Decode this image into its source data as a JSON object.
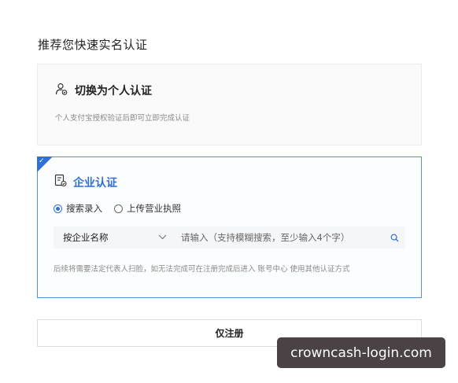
{
  "page": {
    "title": "推荐您快速实名认证"
  },
  "personal_card": {
    "title": "切换为个人认证",
    "description": "个人支付宝授权验证后即可立即完成认证",
    "icon": "user-verify-icon"
  },
  "company_card": {
    "title": "企业认证",
    "icon": "company-document-icon",
    "selected": true,
    "radio_options": [
      {
        "label": "搜索录入",
        "checked": true
      },
      {
        "label": "上传营业执照",
        "checked": false
      }
    ],
    "search": {
      "select_value": "按企业名称",
      "placeholder": "请输入（支持模糊搜索，至少输入4个字）"
    },
    "hint": "后续将需要法定代表人扫脸，如无法完成可在注册完成后进入 账号中心 使用其他认证方式"
  },
  "footer": {
    "register_only_label": "仅注册"
  },
  "watermark": {
    "text": "crowncash-login.com"
  },
  "colors": {
    "accent": "#2f6fd6",
    "selected_border": "#5b8fd6",
    "muted_text": "#8a8a8a"
  }
}
